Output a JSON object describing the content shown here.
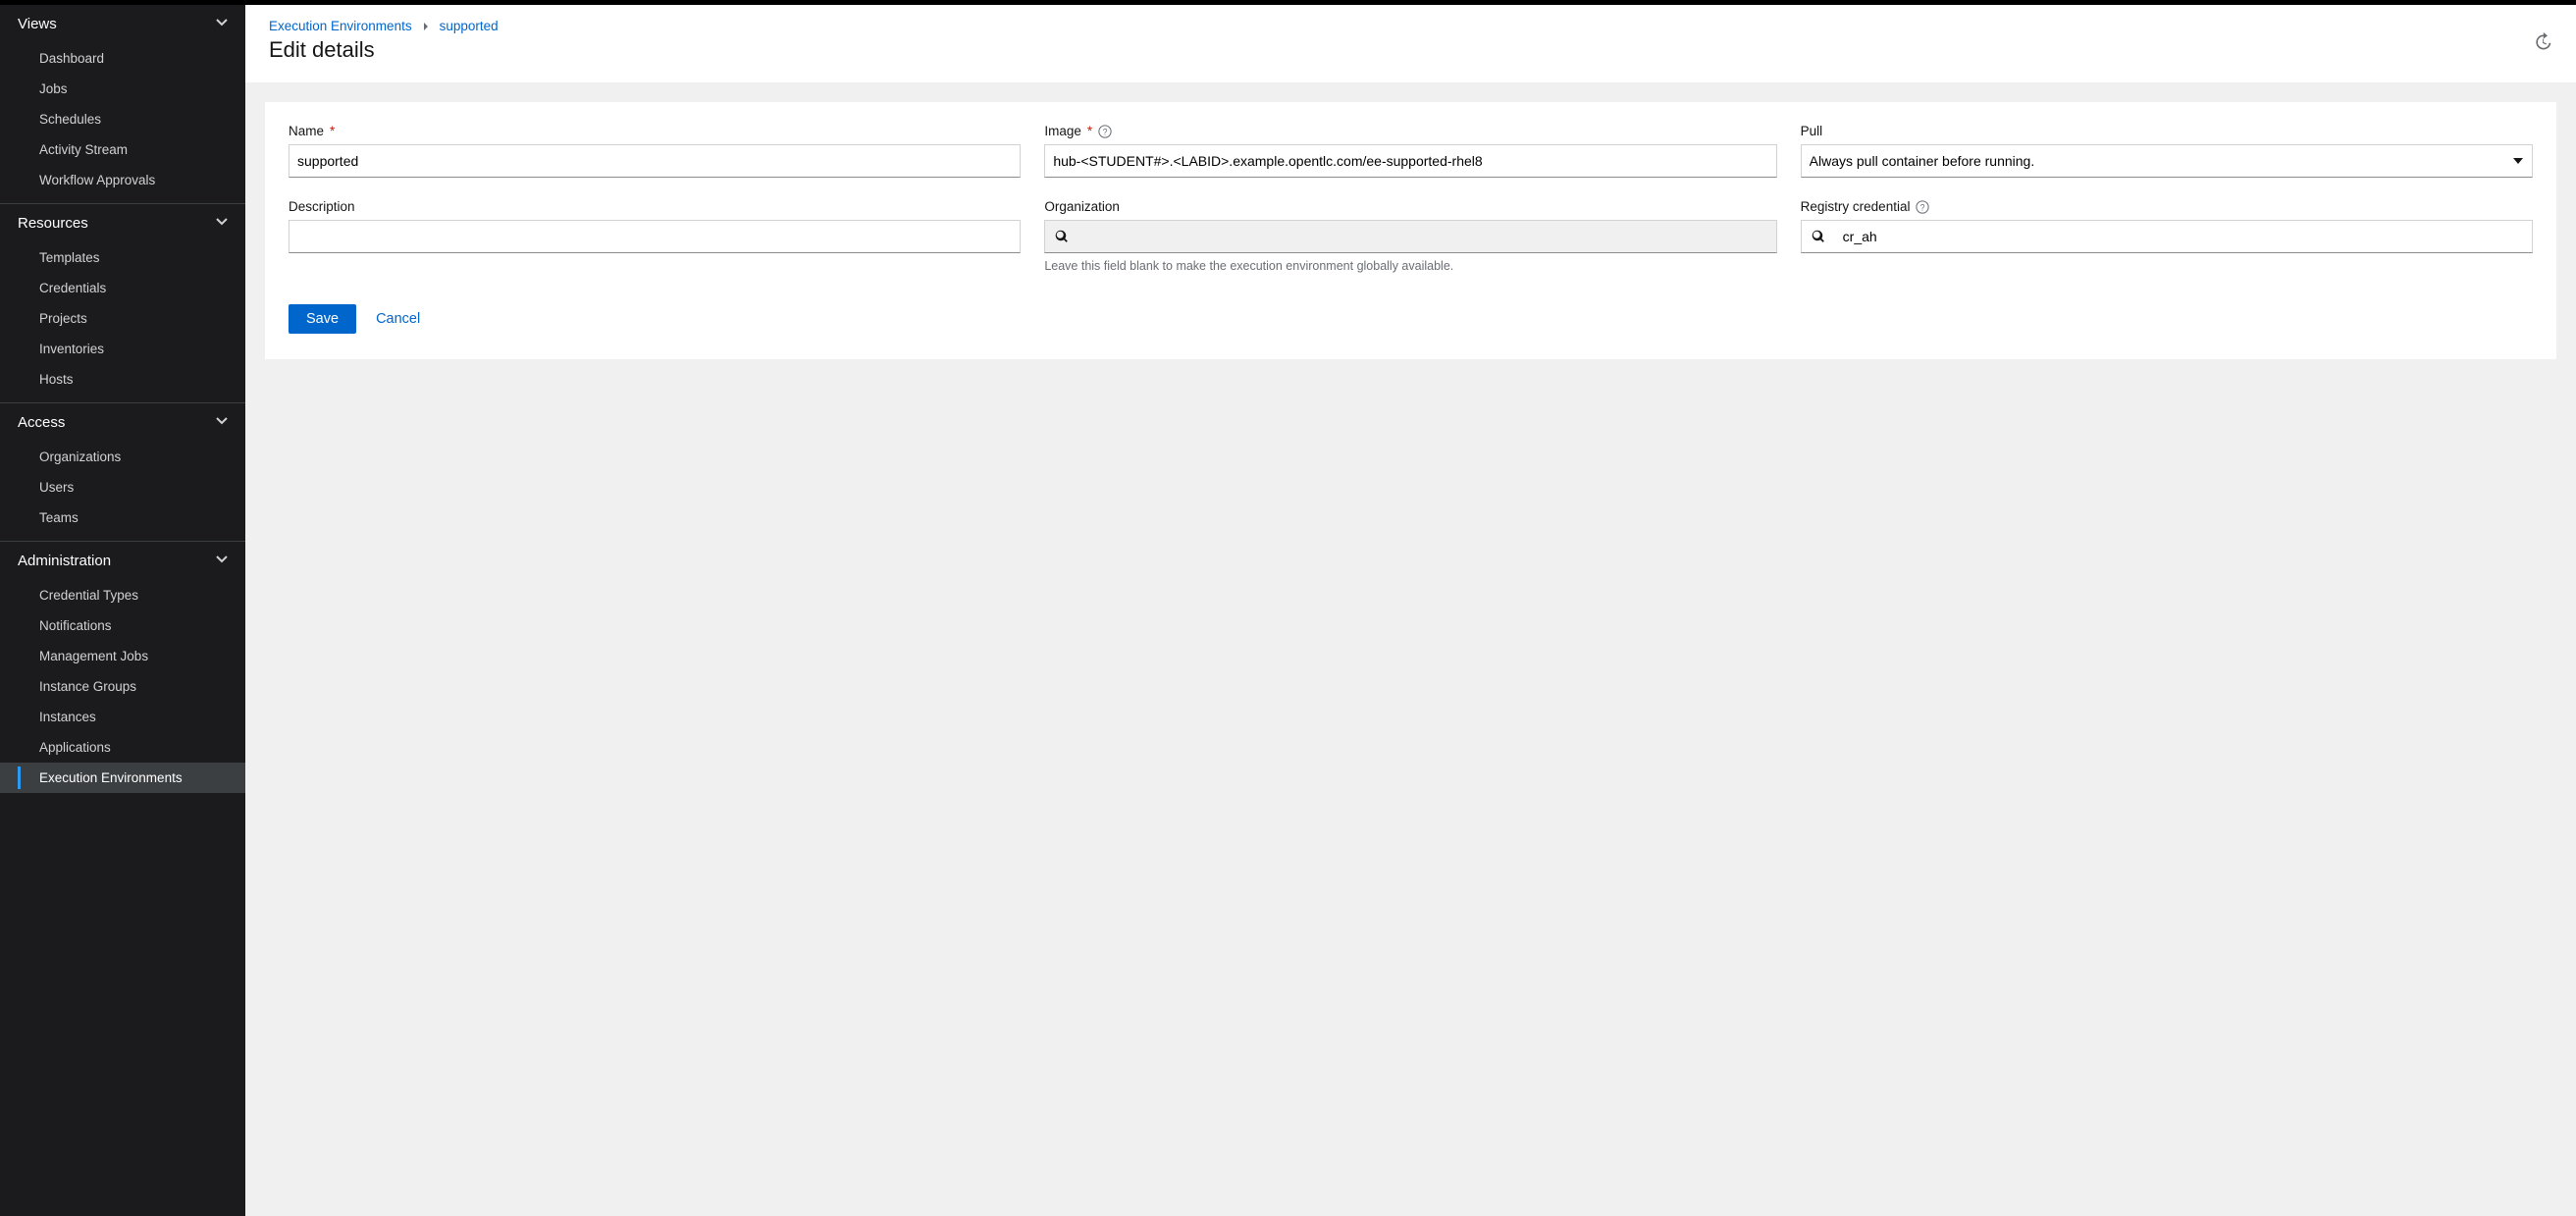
{
  "sidebar": {
    "sections": [
      {
        "key": "views",
        "label": "Views",
        "items": [
          "Dashboard",
          "Jobs",
          "Schedules",
          "Activity Stream",
          "Workflow Approvals"
        ]
      },
      {
        "key": "resources",
        "label": "Resources",
        "items": [
          "Templates",
          "Credentials",
          "Projects",
          "Inventories",
          "Hosts"
        ]
      },
      {
        "key": "access",
        "label": "Access",
        "items": [
          "Organizations",
          "Users",
          "Teams"
        ]
      },
      {
        "key": "admin",
        "label": "Administration",
        "items": [
          "Credential Types",
          "Notifications",
          "Management Jobs",
          "Instance Groups",
          "Instances",
          "Applications",
          "Execution Environments"
        ]
      }
    ],
    "active": "Execution Environments"
  },
  "breadcrumb": {
    "root": "Execution Environments",
    "leaf": "supported"
  },
  "page_title": "Edit details",
  "form": {
    "name": {
      "label": "Name",
      "required": true,
      "value": "supported"
    },
    "image": {
      "label": "Image",
      "required": true,
      "value": "hub-<STUDENT#>.<LABID>.example.opentlc.com/ee-supported-rhel8"
    },
    "pull": {
      "label": "Pull",
      "required": false,
      "value": "Always pull container before running."
    },
    "description": {
      "label": "Description",
      "required": false,
      "value": ""
    },
    "organization": {
      "label": "Organization",
      "required": false,
      "value": "",
      "help": "Leave this field blank to make the execution environment globally available."
    },
    "registry_credential": {
      "label": "Registry credential",
      "required": false,
      "value": "cr_ah"
    }
  },
  "actions": {
    "save": "Save",
    "cancel": "Cancel"
  }
}
